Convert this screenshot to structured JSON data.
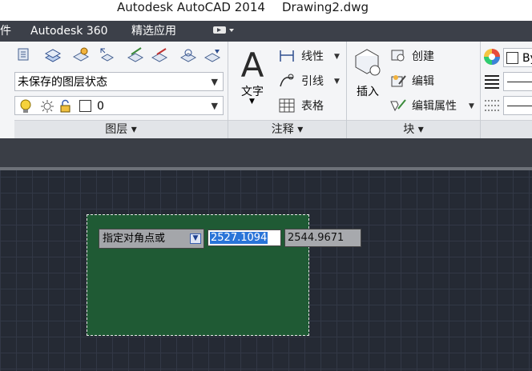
{
  "title": {
    "app": "Autodesk AutoCAD 2014",
    "file": "Drawing2.dwg"
  },
  "menu": {
    "item_partial": "件",
    "autodesk360": "Autodesk 360",
    "featured_apps": "精选应用",
    "extra_arrow": "▾"
  },
  "layers_panel": {
    "state_combo": "未保存的图层状态",
    "current_layer": "0",
    "title": "图层",
    "title_arrow": "▾"
  },
  "annotation_panel": {
    "text_button": "文字",
    "linear": "线性",
    "leader": "引线",
    "table": "表格",
    "title": "注释",
    "title_arrow": "▾"
  },
  "block_panel": {
    "insert": "插入",
    "create": "创建",
    "edit": "编辑",
    "edit_attributes": "编辑属性",
    "title": "块",
    "title_arrow": "▾"
  },
  "properties_panel": {
    "bylayer_partial": "By"
  },
  "dynamic_input": {
    "prompt": "指定对角点或",
    "x_value": "2527.1094",
    "y_value": "2544.9671"
  },
  "colors": {
    "selection_fill": "#1f5a34",
    "canvas": "#252a34",
    "menubar": "#3c4049",
    "highlight": "#2a74d8"
  },
  "icons": [
    "layer-icon",
    "lightbulb-icon",
    "sun-icon",
    "lock-icon",
    "color-swatch-icon",
    "text-A-icon",
    "dimension-icon",
    "leader-icon",
    "table-icon",
    "insert-block-icon",
    "create-block-icon",
    "edit-block-icon",
    "edit-attributes-icon",
    "color-wheel-icon",
    "lineweight-icon",
    "linetype-icon",
    "dropdown-arrow-icon"
  ]
}
